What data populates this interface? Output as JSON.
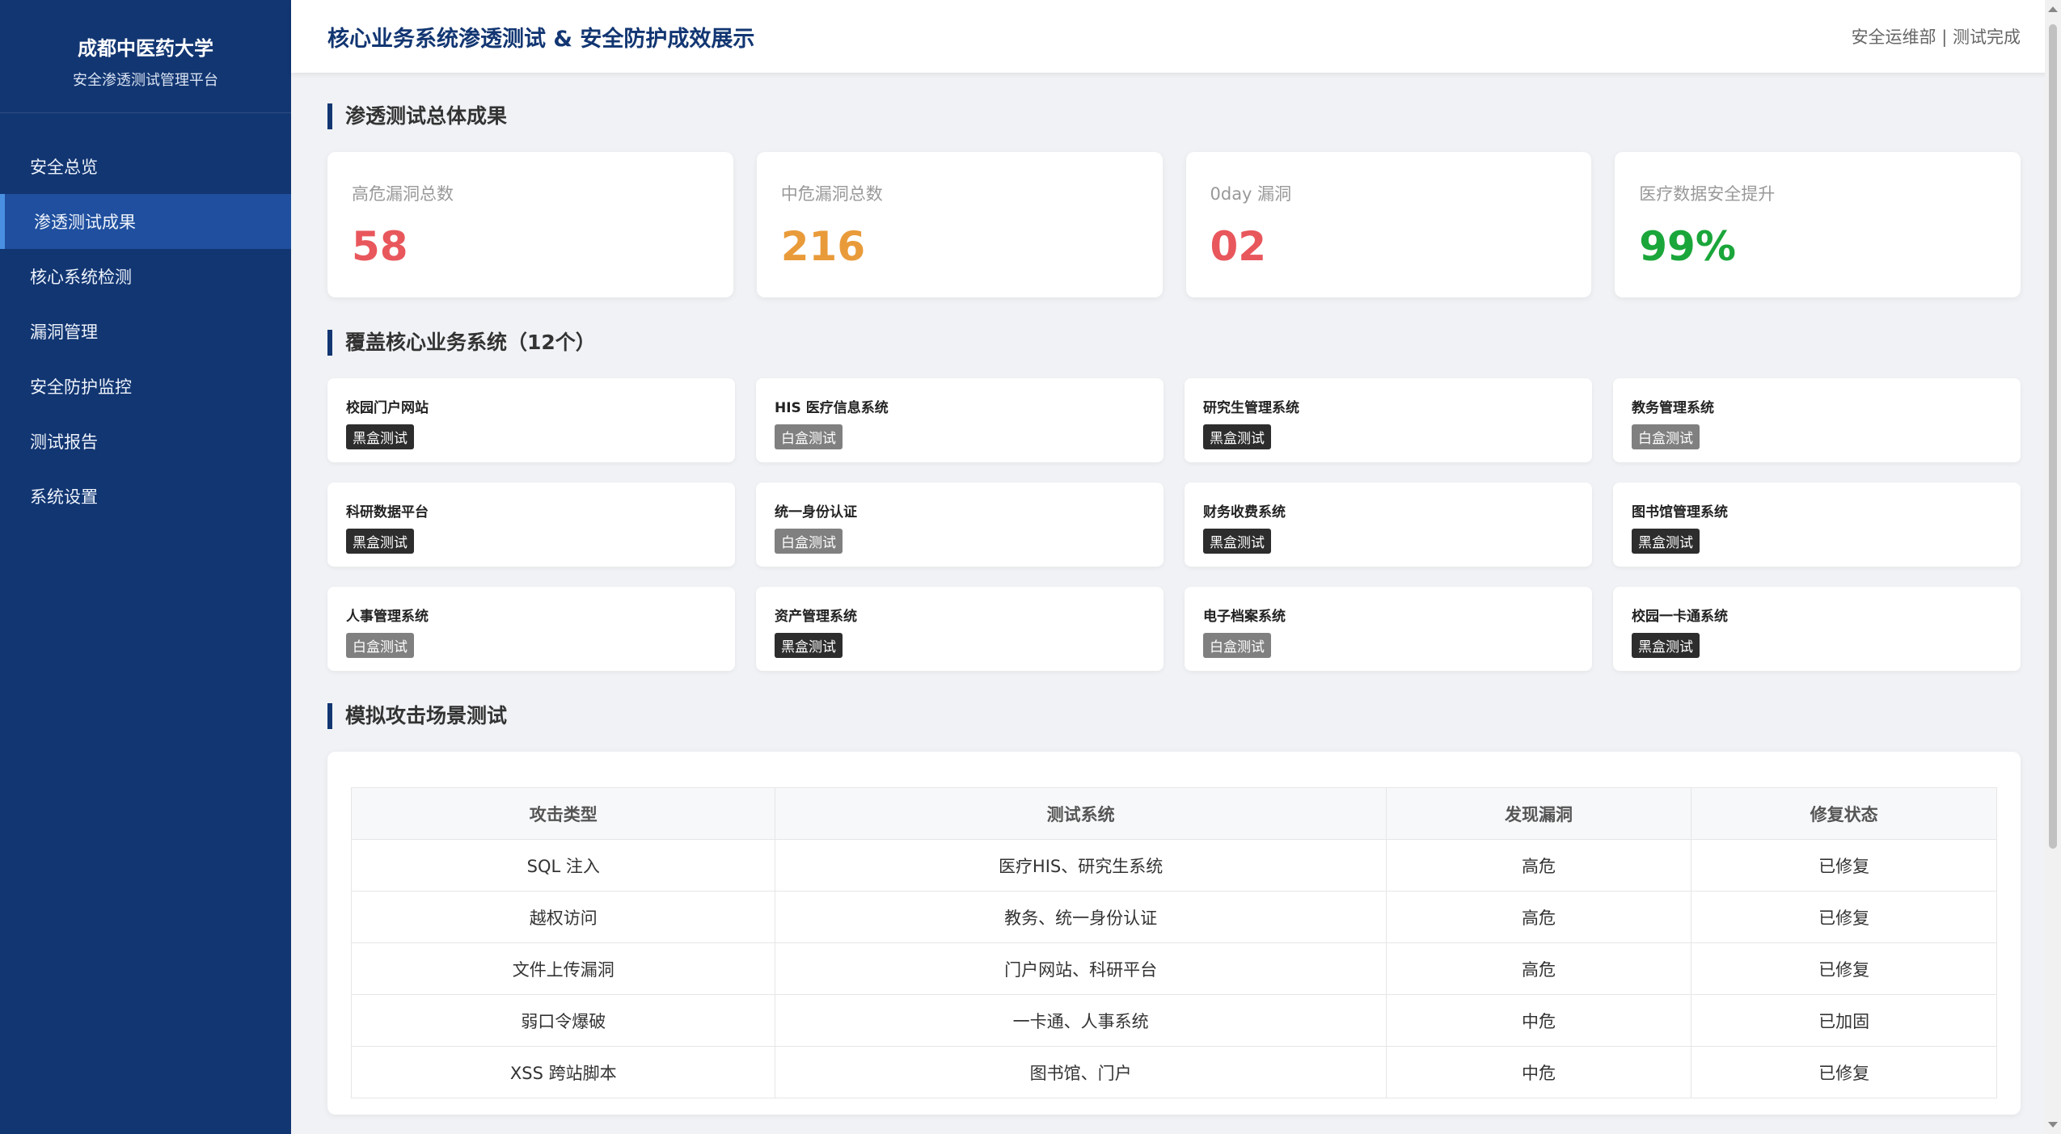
{
  "sidebar": {
    "brand_name": "成都中医药大学",
    "brand_sub": "安全渗透测试管理平台",
    "items": [
      {
        "label": "安全总览"
      },
      {
        "label": "渗透测试成果"
      },
      {
        "label": "核心系统检测"
      },
      {
        "label": "漏洞管理"
      },
      {
        "label": "安全防护监控"
      },
      {
        "label": "测试报告"
      },
      {
        "label": "系统设置"
      }
    ],
    "active_index": 1
  },
  "header": {
    "title": "核心业务系统渗透测试 & 安全防护成效展示",
    "meta": "安全运维部 | 测试完成"
  },
  "stats_section": {
    "title": "渗透测试总体成果",
    "cards": [
      {
        "label": "高危漏洞总数",
        "value": "58",
        "color": "#e8575c"
      },
      {
        "label": "中危漏洞总数",
        "value": "216",
        "color": "#e99b3a"
      },
      {
        "label": "0day 漏洞",
        "value": "02",
        "color": "#e8575c"
      },
      {
        "label": "医疗数据安全提升",
        "value": "99%",
        "color": "#1aa63a"
      }
    ]
  },
  "systems_section": {
    "title": "覆盖核心业务系统（12个）",
    "systems": [
      {
        "name": "校园门户网站",
        "tag": "黑盒测试",
        "type": "black"
      },
      {
        "name": "HIS 医疗信息系统",
        "tag": "白盒测试",
        "type": "white"
      },
      {
        "name": "研究生管理系统",
        "tag": "黑盒测试",
        "type": "black"
      },
      {
        "name": "教务管理系统",
        "tag": "白盒测试",
        "type": "white"
      },
      {
        "name": "科研数据平台",
        "tag": "黑盒测试",
        "type": "black"
      },
      {
        "name": "统一身份认证",
        "tag": "白盒测试",
        "type": "white"
      },
      {
        "name": "财务收费系统",
        "tag": "黑盒测试",
        "type": "black"
      },
      {
        "name": "图书馆管理系统",
        "tag": "黑盒测试",
        "type": "black"
      },
      {
        "name": "人事管理系统",
        "tag": "白盒测试",
        "type": "white"
      },
      {
        "name": "资产管理系统",
        "tag": "黑盒测试",
        "type": "black"
      },
      {
        "name": "电子档案系统",
        "tag": "白盒测试",
        "type": "white"
      },
      {
        "name": "校园一卡通系统",
        "tag": "黑盒测试",
        "type": "black"
      }
    ]
  },
  "attack_section": {
    "title": "模拟攻击场景测试",
    "columns": [
      "攻击类型",
      "测试系统",
      "发现漏洞",
      "修复状态"
    ],
    "rows": [
      [
        "SQL 注入",
        "医疗HIS、研究生系统",
        "高危",
        "已修复"
      ],
      [
        "越权访问",
        "教务、统一身份认证",
        "高危",
        "已修复"
      ],
      [
        "文件上传漏洞",
        "门户网站、科研平台",
        "高危",
        "已修复"
      ],
      [
        "弱口令爆破",
        "一卡通、人事系统",
        "中危",
        "已加固"
      ],
      [
        "XSS 跨站脚本",
        "图书馆、门户",
        "中危",
        "已修复"
      ]
    ]
  }
}
